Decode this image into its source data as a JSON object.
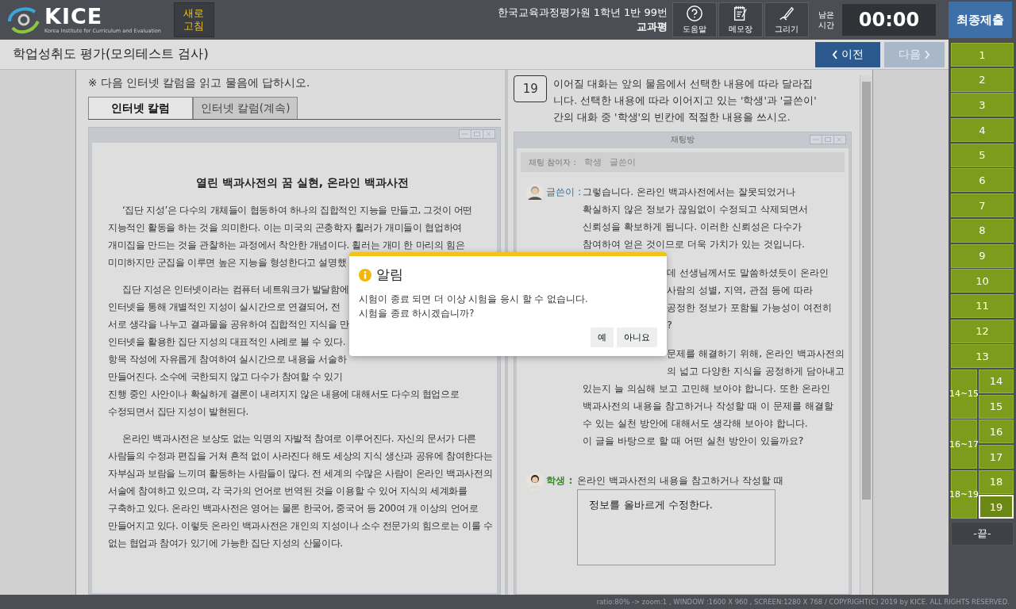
{
  "header": {
    "logo_text": "KICE",
    "logo_subtitle": "Korea Institute for Curriculum and Evaluation",
    "refresh_button": "새로 고침",
    "student": "한국교육과정평가원 1학년 1반 99번",
    "subject": "교과평",
    "tools": [
      {
        "label": "도움말",
        "kind": "help"
      },
      {
        "label": "메모장",
        "kind": "memo"
      },
      {
        "label": "그리기",
        "kind": "draw"
      }
    ],
    "timer_label": "남은 시간",
    "timer": "00:00",
    "submit_button": "최종제출"
  },
  "title_bar": {
    "title": "학업성취도 평가(모의테스트 검사)",
    "prev_button": "이전",
    "next_button": "다음",
    "next_disabled": true
  },
  "passage": {
    "instruction": "※ 다음 인터넷 칼럼을 읽고 물음에 답하시오.",
    "tabs": [
      {
        "label": "인터넷 칼럼",
        "selected": true
      },
      {
        "label": "인터넷 칼럼(계속)",
        "selected": false
      }
    ],
    "heading": "열린 백과사전의 꿈 실현, 온라인 백과사전",
    "paragraphs": [
      {
        "lines": [
          "‘집단 지성’은 다수의 개체들이 협동하여 하나의 집합적인 지능을 만들고, 그것이 어떤",
          "지능적인 활동을 하는 것을 의미한다. 이는 미국의 곤충학자 휠러가 개미들이 협업하여",
          "개미집을 만드는 것을 관찰하는 과정에서 착안한 개념이다. 휠러는 개미 한 마리의 힘은",
          "미미하지만 군집을 이루면 높은 지능을 형성한다고 설명했"
        ]
      },
      {
        "lines": [
          "집단 지성은 인터넷이라는 컴퓨터 네트워크가 발달함에",
          "인터넷을 통해 개별적인 지성이 실시간으로 연결되어, 전",
          "서로 생각을 나누고 결과물을 공유하여 집합적인 지식을 만",
          "인터넷을 활용한 집단 지성의 대표적인 사례로 볼 수 있다.",
          "항목 작성에 자유롭게 참여하여 실시간으로 내용을 서술하",
          "만들어진다. 소수에 국한되지 않고 다수가 참여할 수 있기",
          "진행 중인 사안이나 확실하게 결론이 내려지지 않은 내용에 대해서도 다수의 협업으로",
          "수정되면서 집단 지성이 발현된다."
        ]
      },
      {
        "lines": [
          "온라인 백과사전은 보상도 없는 익명의 자발적 참여로 이루어진다. 자신의 문서가 다른",
          "사람들의 수정과 편집을 거쳐 흔적 없이 사라진다 해도 세상의 지식 생산과 공유에 참여한다는",
          "자부심과 보람을 느끼며 활동하는 사람들이 많다. 전 세계의 수많은 사람이 온라인 백과사전의",
          "서술에 참여하고 있으며, 각 국가의 언어로 번역된 것을 이용할 수 있어 지식의 세계화를",
          "구축하고 있다. 온라인 백과사전은 영어는 물론 한국어, 중국어 등 200여 개 이상의 언어로",
          "만들어지고 있다. 이렇듯 온라인 백과사전은 개인의 지성이나 소수 전문가의 힘으로는 이룰 수",
          "없는 협업과 참여가 있기에 가능한 집단 지성의 산물이다."
        ]
      }
    ]
  },
  "question": {
    "number": "19",
    "text": "이어질 대화는 앞의 물음에서 선택한 내용에 따라 달라집니다. 선택한 내용에 따라 이어지고 있는 '학생'과 '글쓴이' 간의 대화 중 '학생'의 빈칸에 적절한 내용을 쓰시오."
  },
  "chat": {
    "title": "채팅방",
    "participants_label": "채팅 참여자 :",
    "participants": [
      "학생",
      "글쓴이"
    ],
    "messages": [
      {
        "speaker": "글쓴이 :",
        "kind": "writer",
        "paragraphs": [
          {
            "lines": [
              "그렇습니다. 온라인 백과사전에서는 잘못되었거나",
              "확실하지 않은 정보가 끊임없이 수정되고 삭제되면서",
              "신뢰성을 확보하게 됩니다. 이러한 신뢰성은 다수가",
              "참여하여 얻은 것이므로 더욱 가치가 있는 것입니다."
            ]
          },
          {
            "fragments": [
              "데 선생님께서도 말씀하셨듯이 온라인",
              "사람의 성별, 지역, 관점 등에 따라",
              "공정한 정보가 포함될 가능성이 여전히",
              "?"
            ]
          },
          {
            "fragments": [
              "문제를 해결하기 위해, 온라인 백과사전의",
              "의 넓고 다양한 지식을 공정하게 담아내고"
            ],
            "lines": [
              "있는지 늘 의심해 보고 고민해 보아야 합니다. 또한 온라인",
              "백과사전의 내용을 참고하거나 작성할 때 이 문제를 해결할",
              "수 있는 실천 방안에 대해서도 생각해 보아야 합니다.",
              "이 글을 바탕으로 할 때 어떤 실천 방안이 있을까요?"
            ]
          }
        ]
      },
      {
        "speaker": "학생 :",
        "kind": "student",
        "paragraphs": [
          {
            "lines": [
              "온라인 백과사전의 내용을 참고하거나 작성할 때"
            ]
          }
        ],
        "answer": "정보를 올바르게 수정한다."
      }
    ]
  },
  "sidebar": {
    "questions": [
      {
        "kind": "single",
        "label": "1",
        "selected": false
      },
      {
        "kind": "single",
        "label": "2",
        "selected": false
      },
      {
        "kind": "single",
        "label": "3",
        "selected": false
      },
      {
        "kind": "single",
        "label": "4",
        "selected": false
      },
      {
        "kind": "single",
        "label": "5",
        "selected": false
      },
      {
        "kind": "single",
        "label": "6",
        "selected": false
      },
      {
        "kind": "single",
        "label": "7",
        "selected": false
      },
      {
        "kind": "single",
        "label": "8",
        "selected": false
      },
      {
        "kind": "single",
        "label": "9",
        "selected": false
      },
      {
        "kind": "single",
        "label": "10",
        "selected": false
      },
      {
        "kind": "single",
        "label": "11",
        "selected": false
      },
      {
        "kind": "single",
        "label": "12",
        "selected": false
      },
      {
        "kind": "single",
        "label": "13",
        "selected": false
      },
      {
        "kind": "group",
        "label": "14~15",
        "children": [
          {
            "label": "14",
            "selected": false
          },
          {
            "label": "15",
            "selected": false
          }
        ]
      },
      {
        "kind": "group",
        "label": "16~17",
        "children": [
          {
            "label": "16",
            "selected": false
          },
          {
            "label": "17",
            "selected": false
          }
        ]
      },
      {
        "kind": "group",
        "label": "18~19",
        "children": [
          {
            "label": "18",
            "selected": false
          },
          {
            "label": "19",
            "selected": true
          }
        ]
      }
    ],
    "end_button": "-끝-"
  },
  "dialog": {
    "title": "알림",
    "lines": [
      "시험이 종료 되면 더 이상 시험을 응시 할 수 없습니다.",
      "시험을 종료 하시겠습니까?"
    ],
    "buttons": [
      "예",
      "아니요"
    ]
  },
  "status_bar": "ratio:80% -> zoom:1 , WINDOW :1600 X 960 , SCREEN:1280 X 768 / COPYRIGHT(C) 2019 by KICE. ALL RIGHTS RESERVED."
}
